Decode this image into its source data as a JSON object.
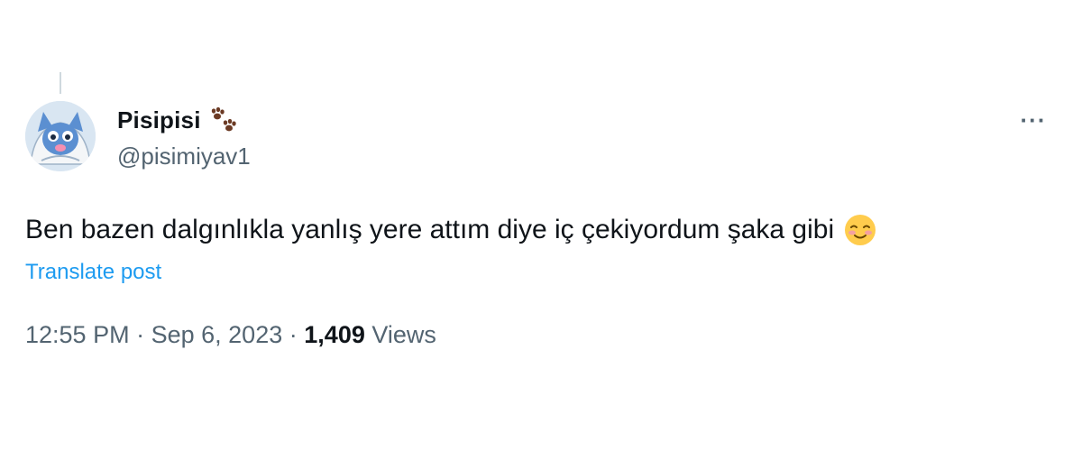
{
  "tweet": {
    "author": {
      "display_name": "Pisipisi",
      "handle": "@pisimiyav1",
      "name_badge_icon": "paw-prints-icon",
      "avatar_icon": "cat-avatar"
    },
    "more_icon": "more-horizontal-icon",
    "more_label": "···",
    "text": "Ben bazen dalgınlıkla yanlış yere attım diye iç çekiyordum şaka gibi",
    "emoji_icon": "smiling-face-with-rosy-cheeks-icon",
    "translate_label": "Translate post",
    "time": "12:55 PM",
    "separator": "·",
    "date": "Sep 6, 2023",
    "views_count": "1,409",
    "views_label": "Views"
  },
  "colors": {
    "text_primary": "#0f1419",
    "text_secondary": "#536471",
    "link": "#1d9bf0",
    "paw": "#6b3a24"
  }
}
